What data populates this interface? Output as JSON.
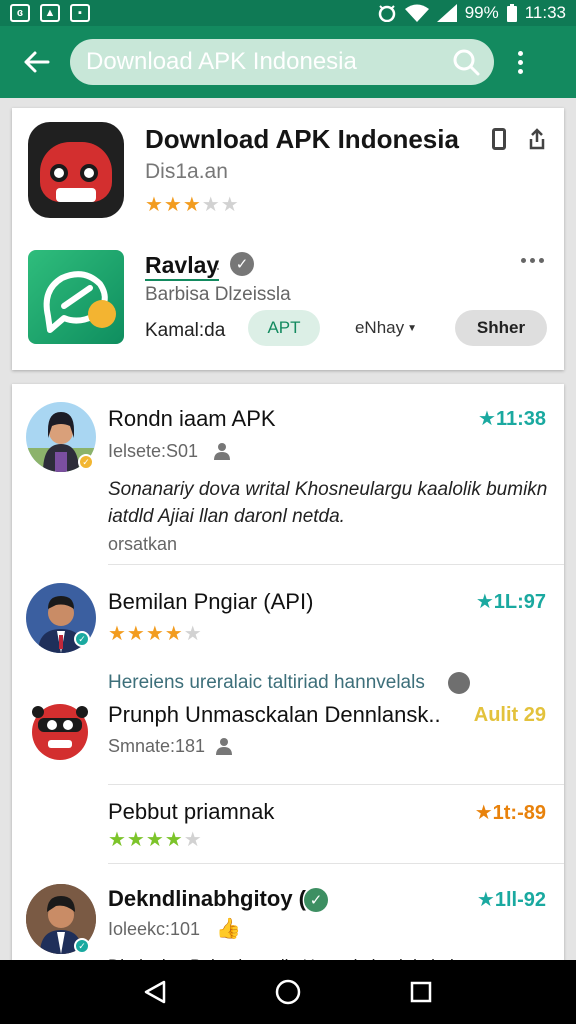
{
  "status_bar": {
    "battery": "99%",
    "time": "11:33"
  },
  "search": {
    "value": "Download APK Indonesia"
  },
  "top_card": {
    "app1": {
      "title": "Download APK Indonesia",
      "subtitle": "Dis1a.an",
      "rating": 3
    },
    "app2": {
      "title": "Ravlay",
      "separator": "·",
      "subtitle": "Barbisa Dlzeissla",
      "label": "Kamal:da",
      "chips": {
        "apt": "APT",
        "enhay": "eNhay",
        "share": "Shher"
      }
    }
  },
  "reviews": [
    {
      "title": "Rondn iaam APK",
      "sub": "Ielsete:S01",
      "rating": "★11:38",
      "body": "Sonanariy dova writal Khosneulargu kaalolik bumikn iatdld Ajiai llan daronl netda.",
      "note": "orsatkan"
    },
    {
      "title": "Bemilan  Pngiar (API)",
      "rating": "★1L:97",
      "stars": 4
    },
    {
      "section_heading": "Hereiens ureralaic taltiriad hannvelals"
    },
    {
      "title": "Prunph Unmasckalan Dennlansk..",
      "sub": "Smnate:181",
      "rating": "Aulit 29"
    },
    {
      "title": "Pebbut priamnak",
      "rating": "★1t:-89",
      "stars": 4
    },
    {
      "title": "Dekndlinabhgitoy  (",
      "sub": "Ioleekc:101",
      "rating": "★1ll-92",
      "body": "Dirnkmbm Bnbashmnelln Horsaritulemb lmbal"
    }
  ],
  "colors": {
    "primary": "#138a5f",
    "status_bar": "#0f7a55",
    "search_bg": "#c8e7d8",
    "star": "#f29c1f",
    "rating_teal": "#1aa9a0"
  },
  "icons": [
    "back-arrow-icon",
    "search-icon",
    "more-vert-icon",
    "phone-icon",
    "share-icon",
    "verified-icon",
    "more-horiz-icon",
    "user-icon",
    "nav-back-icon",
    "nav-home-icon",
    "nav-recent-icon"
  ]
}
